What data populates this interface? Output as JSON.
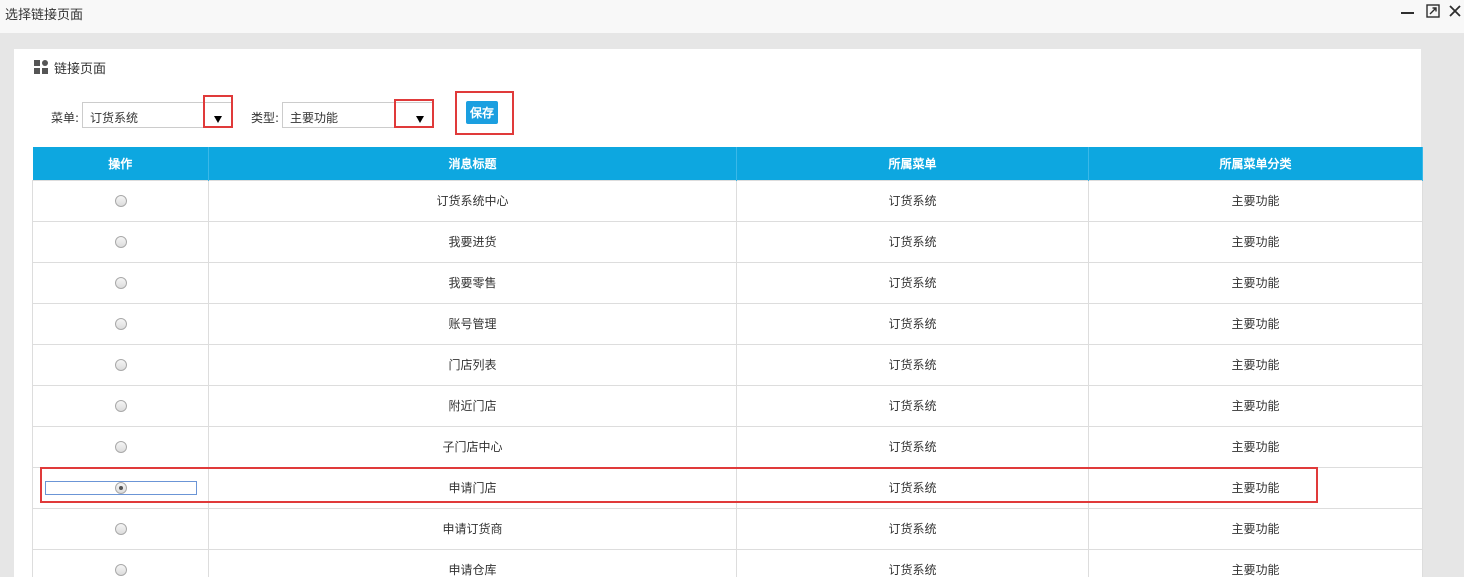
{
  "window": {
    "title": "选择链接页面"
  },
  "panel": {
    "title": "链接页面"
  },
  "filters": {
    "menu_label": "菜单:",
    "menu_value": "订货系统",
    "type_label": "类型:",
    "type_value": "主要功能",
    "save_label": "保存"
  },
  "table": {
    "headers": [
      "操作",
      "消息标题",
      "所属菜单",
      "所属菜单分类"
    ],
    "rows": [
      {
        "title": "订货系统中心",
        "menu": "订货系统",
        "category": "主要功能"
      },
      {
        "title": "我要进货",
        "menu": "订货系统",
        "category": "主要功能"
      },
      {
        "title": "我要零售",
        "menu": "订货系统",
        "category": "主要功能"
      },
      {
        "title": "账号管理",
        "menu": "订货系统",
        "category": "主要功能"
      },
      {
        "title": "门店列表",
        "menu": "订货系统",
        "category": "主要功能"
      },
      {
        "title": "附近门店",
        "menu": "订货系统",
        "category": "主要功能"
      },
      {
        "title": "子门店中心",
        "menu": "订货系统",
        "category": "主要功能"
      },
      {
        "title": "申请门店",
        "menu": "订货系统",
        "category": "主要功能"
      },
      {
        "title": "申请订货商",
        "menu": "订货系统",
        "category": "主要功能"
      },
      {
        "title": "申请仓库",
        "menu": "订货系统",
        "category": "主要功能"
      }
    ],
    "selected_index": 7
  },
  "colors": {
    "header_bg": "#0da7e0",
    "highlight": "#e03a3a",
    "button": "#1b9fe0"
  }
}
